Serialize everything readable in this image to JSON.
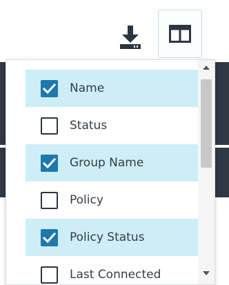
{
  "toolbar": {
    "download_icon": "download-icon",
    "columns_icon": "columns-icon"
  },
  "columns_menu": {
    "items": [
      {
        "label": "Name",
        "checked": true
      },
      {
        "label": "Status",
        "checked": false
      },
      {
        "label": "Group Name",
        "checked": true
      },
      {
        "label": "Policy",
        "checked": false
      },
      {
        "label": "Policy Status",
        "checked": true
      },
      {
        "label": "Last Connected",
        "checked": false
      }
    ]
  },
  "colors": {
    "accent": "#1d79ad",
    "selected_row": "#cdeef6",
    "icon": "#2c3440"
  }
}
